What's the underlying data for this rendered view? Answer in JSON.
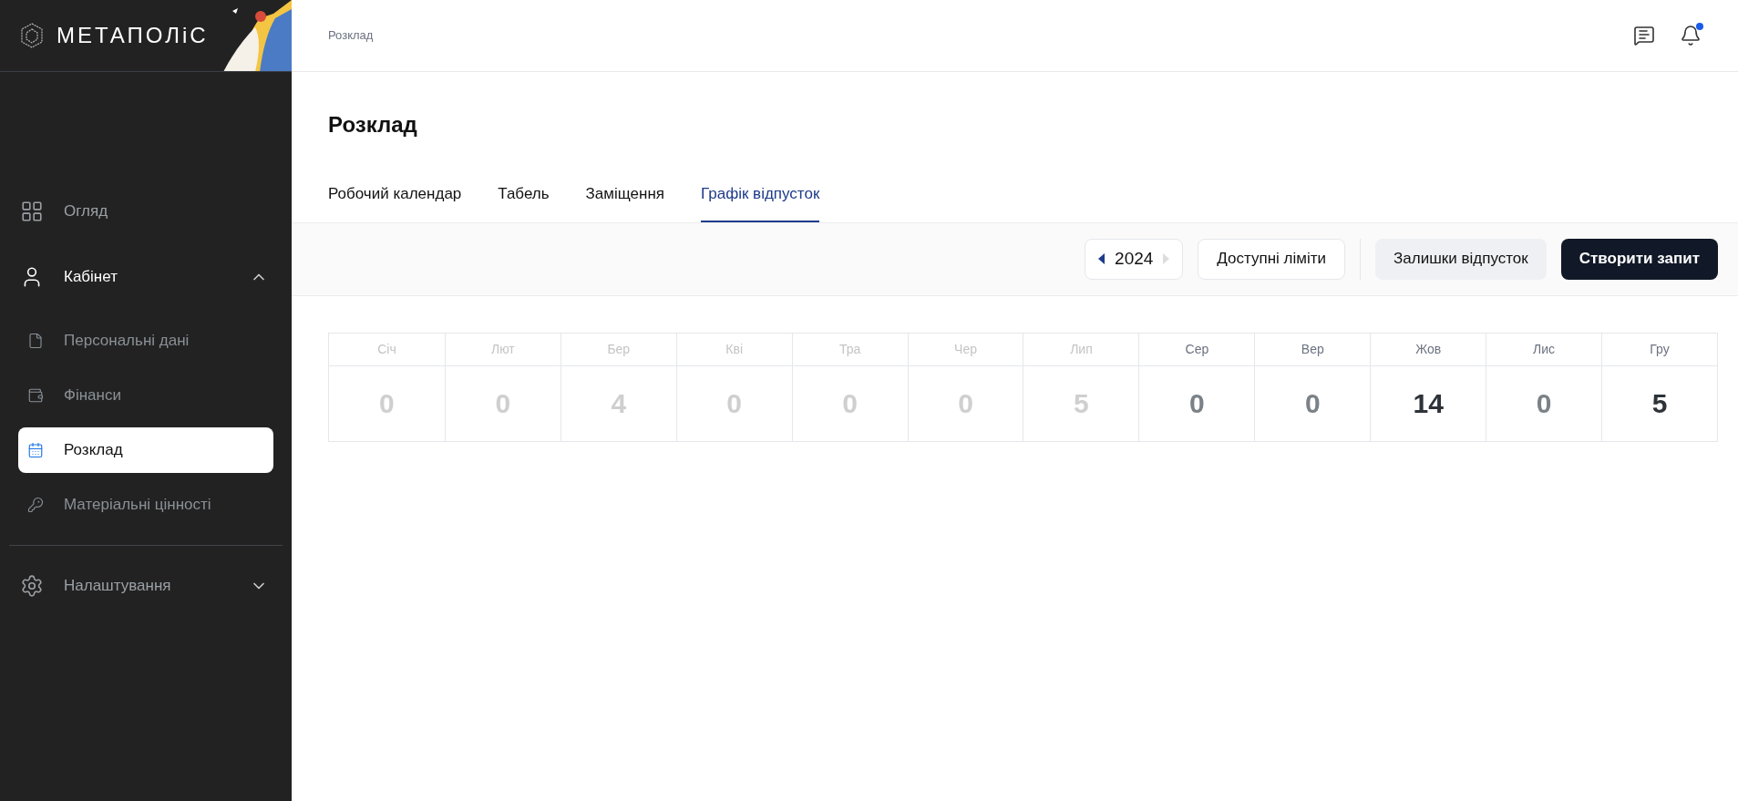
{
  "logo": {
    "text": "МЕТАПОЛіС"
  },
  "sidebar": {
    "items": [
      {
        "kind": "link",
        "label": "Огляд",
        "selected": false
      },
      {
        "kind": "group",
        "label": "Кабінет",
        "expanded": true,
        "children": [
          {
            "label": "Персональні дані",
            "selected": false
          },
          {
            "label": "Фінанси",
            "selected": false
          },
          {
            "label": "Розклад",
            "selected": true
          },
          {
            "label": "Матеріальні цінності",
            "selected": false
          }
        ]
      },
      {
        "kind": "divider"
      },
      {
        "kind": "group",
        "label": "Налаштування",
        "expanded": false
      }
    ]
  },
  "header": {
    "breadcrumb": "Розклад",
    "notification_dot": true
  },
  "page": {
    "title": "Розклад"
  },
  "tabs": [
    {
      "label": "Робочий календар",
      "selected": false
    },
    {
      "label": "Табель",
      "selected": false
    },
    {
      "label": "Заміщення",
      "selected": false
    },
    {
      "label": "Графік відпусток",
      "selected": true
    }
  ],
  "toolbar": {
    "year": "2024",
    "prev_disabled": false,
    "next_disabled": true,
    "buttons": [
      {
        "kind": "outline",
        "label": "Доступні ліміти"
      },
      {
        "kind": "divider"
      },
      {
        "kind": "secondary",
        "label": "Залишки відпусток"
      },
      {
        "kind": "primary",
        "label": "Створити запит"
      }
    ]
  },
  "months": [
    {
      "name": "Січ",
      "value": "0",
      "past": true
    },
    {
      "name": "Лют",
      "value": "0",
      "past": true
    },
    {
      "name": "Бер",
      "value": "4",
      "past": true
    },
    {
      "name": "Кві",
      "value": "0",
      "past": true
    },
    {
      "name": "Тра",
      "value": "0",
      "past": true
    },
    {
      "name": "Чер",
      "value": "0",
      "past": true
    },
    {
      "name": "Лип",
      "value": "5",
      "past": true
    },
    {
      "name": "Сер",
      "value": "0",
      "past": false,
      "emphasized": false
    },
    {
      "name": "Вер",
      "value": "0",
      "past": false,
      "emphasized": false
    },
    {
      "name": "Жов",
      "value": "14",
      "past": false,
      "emphasized": true
    },
    {
      "name": "Лис",
      "value": "0",
      "past": false,
      "emphasized": false
    },
    {
      "name": "Гру",
      "value": "5",
      "past": false,
      "emphasized": true
    }
  ]
}
